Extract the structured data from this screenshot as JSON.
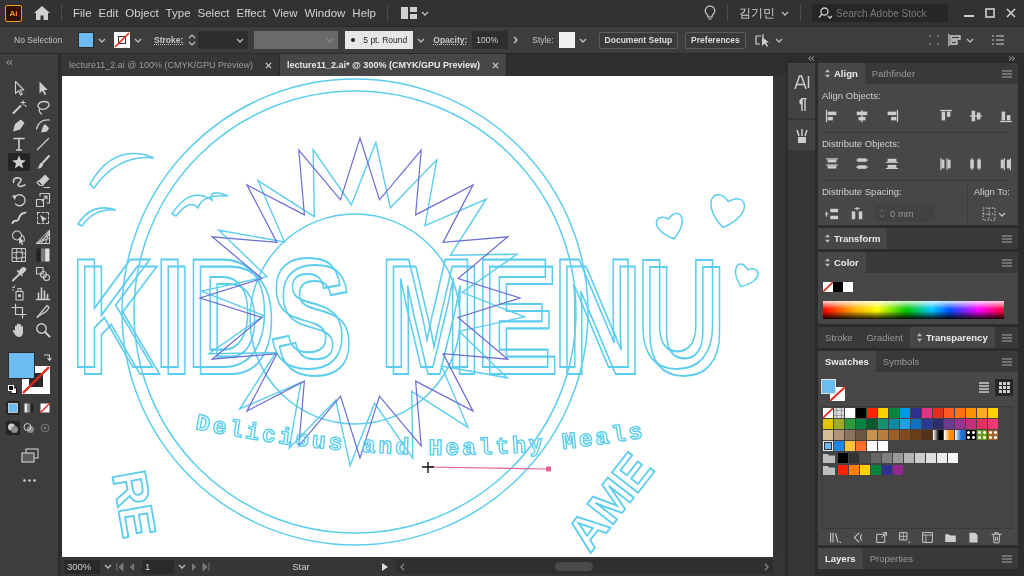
{
  "menu_bar": {
    "logo": "Ai",
    "menus": [
      "File",
      "Edit",
      "Object",
      "Type",
      "Select",
      "Effect",
      "View",
      "Window",
      "Help"
    ],
    "user": "김기민",
    "search": {
      "placeholder": "Search Adobe Stock"
    }
  },
  "control_bar": {
    "selection": "No Selection",
    "stroke_label": "Stroke:",
    "brush": "5 pt. Round",
    "opacity_label": "Opacity:",
    "opacity": "100%",
    "style_label": "Style:",
    "buttons": [
      "Document Setup",
      "Preferences"
    ]
  },
  "document_tabs": [
    {
      "title": "lecture11_2.ai @ 100% (CMYK/GPU Preview)",
      "selected": false
    },
    {
      "title": "lecture11_2.ai* @ 300% (CMYK/GPU Preview)",
      "selected": true
    }
  ],
  "toolbar": {
    "tools": [
      {
        "kind": "selection",
        "selected": false
      },
      {
        "kind": "direct",
        "selected": false
      },
      {
        "kind": "wand",
        "selected": false
      },
      {
        "kind": "lasso",
        "selected": false
      },
      {
        "kind": "pen",
        "selected": false
      },
      {
        "kind": "curvature",
        "selected": false
      },
      {
        "kind": "type",
        "selected": false
      },
      {
        "kind": "line",
        "selected": false
      },
      {
        "kind": "star",
        "selected": true
      },
      {
        "kind": "brush",
        "selected": false
      },
      {
        "kind": "shaper",
        "selected": false
      },
      {
        "kind": "eraser",
        "selected": false
      },
      {
        "kind": "rotate",
        "selected": false
      },
      {
        "kind": "scale",
        "selected": false
      },
      {
        "kind": "warp",
        "selected": false
      },
      {
        "kind": "freetransform",
        "selected": false
      },
      {
        "kind": "shapebuilder",
        "selected": false
      },
      {
        "kind": "perspective",
        "selected": false
      },
      {
        "kind": "mesh",
        "selected": false
      },
      {
        "kind": "gradient",
        "selected": false
      },
      {
        "kind": "eyedropper",
        "selected": false
      },
      {
        "kind": "blend",
        "selected": false
      },
      {
        "kind": "sprayer",
        "selected": false
      },
      {
        "kind": "graph",
        "selected": false
      },
      {
        "kind": "artboard",
        "selected": false
      },
      {
        "kind": "slice",
        "selected": false
      },
      {
        "kind": "hand",
        "selected": false
      },
      {
        "kind": "zoom",
        "selected": false
      }
    ],
    "color_modes": [
      {
        "kind": "color",
        "selected": true
      },
      {
        "kind": "gradient",
        "selected": false
      },
      {
        "kind": "none",
        "selected": false
      }
    ],
    "draw_modes": [
      {
        "kind": "normal",
        "selected": true
      },
      {
        "kind": "behind",
        "selected": false
      },
      {
        "kind": "inside",
        "selected": false
      }
    ]
  },
  "artwork": {
    "title_words": [
      "KIDS",
      "MENU"
    ],
    "tagline": "Delicious and Healthy Meals",
    "arc_texts": [
      "RE",
      "AME"
    ]
  },
  "align_panel": {
    "tabs": [
      {
        "label": "Align",
        "selected": true
      },
      {
        "label": "Pathfinder",
        "selected": false
      }
    ],
    "align_objects_label": "Align Objects:",
    "distribute_objects_label": "Distribute Objects:",
    "distribute_spacing_label": "Distribute Spacing:",
    "spacing": {
      "value": "0 mm",
      "disabled": true
    },
    "align_to_label": "Align To:"
  },
  "transform_panel": {
    "tabs": [
      {
        "label": "Transform",
        "selected": true
      }
    ]
  },
  "color_panel": {
    "tabs": [
      {
        "label": "Color",
        "selected": true
      }
    ]
  },
  "appearance_panel": {
    "tabs": [
      {
        "label": "Stroke",
        "selected": false
      },
      {
        "label": "Gradient",
        "selected": false
      },
      {
        "label": "Transparency",
        "selected": true
      }
    ]
  },
  "swatches_panel": {
    "tabs": [
      {
        "label": "Swatches",
        "selected": true
      },
      {
        "label": "Symbols",
        "selected": false
      }
    ],
    "views": [
      {
        "kind": "list",
        "selected": false
      },
      {
        "kind": "grid",
        "selected": true
      }
    ],
    "swatches": [
      {
        "kind": "none",
        "selected": false
      },
      {
        "kind": "registration",
        "selected": false
      },
      {
        "kind": "color",
        "color": "#ffffff",
        "selected": false
      },
      {
        "kind": "color",
        "color": "#000000",
        "selected": false
      },
      {
        "kind": "color",
        "color": "#ff2400",
        "selected": false
      },
      {
        "kind": "color",
        "color": "#ffd200",
        "selected": false
      },
      {
        "kind": "color",
        "color": "#00853f",
        "selected": false
      },
      {
        "kind": "color",
        "color": "#0096e8",
        "selected": false
      },
      {
        "kind": "color",
        "color": "#2e3192",
        "selected": false
      },
      {
        "kind": "color",
        "color": "#ec2f86",
        "selected": false
      },
      {
        "kind": "color",
        "color": "#e0301e",
        "selected": false
      },
      {
        "kind": "color",
        "color": "#ff5a1f",
        "selected": false
      },
      {
        "kind": "color",
        "color": "#ff7113",
        "selected": false
      },
      {
        "kind": "color",
        "color": "#ff9200",
        "selected": false
      },
      {
        "kind": "color",
        "color": "#ffac1e",
        "selected": false
      },
      {
        "kind": "color",
        "color": "#ffd400",
        "selected": false
      },
      {
        "kind": "color",
        "color": "#e3c600",
        "selected": false
      },
      {
        "kind": "color",
        "color": "#9cad1f",
        "selected": false
      },
      {
        "kind": "color",
        "color": "#2c9b39",
        "selected": false
      },
      {
        "kind": "color",
        "color": "#008340",
        "selected": false
      },
      {
        "kind": "color",
        "color": "#005c2e",
        "selected": false
      },
      {
        "kind": "color",
        "color": "#16916e",
        "selected": false
      },
      {
        "kind": "color",
        "color": "#0a8ba0",
        "selected": false
      },
      {
        "kind": "color",
        "color": "#209fe6",
        "selected": false
      },
      {
        "kind": "color",
        "color": "#1071c4",
        "selected": false
      },
      {
        "kind": "color",
        "color": "#2b3a8f",
        "selected": false
      },
      {
        "kind": "color",
        "color": "#2c2d6c",
        "selected": false
      },
      {
        "kind": "color",
        "color": "#6a3b8f",
        "selected": false
      },
      {
        "kind": "color",
        "color": "#983592",
        "selected": false
      },
      {
        "kind": "color",
        "color": "#c1307b",
        "selected": false
      },
      {
        "kind": "color",
        "color": "#e6305f",
        "selected": false
      },
      {
        "kind": "color",
        "color": "#ee3b73",
        "selected": false
      },
      {
        "kind": "color",
        "color": "#d8be96",
        "selected": false
      },
      {
        "kind": "color",
        "color": "#b39479",
        "selected": false
      },
      {
        "kind": "color",
        "color": "#8b7560",
        "selected": false
      },
      {
        "kind": "color",
        "color": "#6d5641",
        "selected": false
      },
      {
        "kind": "color",
        "color": "#c99451",
        "selected": false
      },
      {
        "kind": "color",
        "color": "#b77e3d",
        "selected": false
      },
      {
        "kind": "color",
        "color": "#9c5f26",
        "selected": false
      },
      {
        "kind": "color",
        "color": "#824a1d",
        "selected": false
      },
      {
        "kind": "color",
        "color": "#6a3d14",
        "selected": false
      },
      {
        "kind": "color",
        "color": "#52331a",
        "selected": false
      },
      {
        "kind": "gradient",
        "color": "#000000",
        "selected": false
      },
      {
        "kind": "gradient",
        "color": "#ff8a00",
        "selected": false
      },
      {
        "kind": "gradient",
        "color": "#1e6fd9",
        "selected": false
      },
      {
        "kind": "pattern",
        "color": "#000000",
        "selected": false
      },
      {
        "kind": "pattern",
        "color": "#6a9a1e",
        "selected": false
      },
      {
        "kind": "pattern",
        "color": "#a0643c",
        "selected": false
      },
      {
        "kind": "color",
        "color": "#6ab8f0",
        "selected": true
      },
      {
        "kind": "color",
        "color": "#1e88e5",
        "selected": false
      },
      {
        "kind": "color",
        "color": "#ffc43a",
        "selected": false
      },
      {
        "kind": "color",
        "color": "#ff6d2e",
        "selected": false
      },
      {
        "kind": "color",
        "color": "#ffffff",
        "selected": false
      },
      {
        "kind": "color",
        "color": "#ffffff",
        "selected": false
      }
    ],
    "groups": [
      {
        "swatches": [
          {
            "kind": "color",
            "color": "#000000",
            "selected": false
          },
          {
            "kind": "color",
            "color": "#333333",
            "selected": false
          },
          {
            "kind": "color",
            "color": "#4d4d4d",
            "selected": false
          },
          {
            "kind": "color",
            "color": "#666666",
            "selected": false
          },
          {
            "kind": "color",
            "color": "#808080",
            "selected": false
          },
          {
            "kind": "color",
            "color": "#999999",
            "selected": false
          },
          {
            "kind": "color",
            "color": "#b3b3b3",
            "selected": false
          },
          {
            "kind": "color",
            "color": "#cccccc",
            "selected": false
          },
          {
            "kind": "color",
            "color": "#e0e0e0",
            "selected": false
          },
          {
            "kind": "color",
            "color": "#ededed",
            "selected": false
          },
          {
            "kind": "color",
            "color": "#f7f7f7",
            "selected": false
          }
        ]
      },
      {
        "swatches": [
          {
            "kind": "color",
            "color": "#ff2400",
            "selected": false
          },
          {
            "kind": "color",
            "color": "#ff7f00",
            "selected": false
          },
          {
            "kind": "color",
            "color": "#ffd200",
            "selected": false
          },
          {
            "kind": "color",
            "color": "#00853f",
            "selected": false
          },
          {
            "kind": "color",
            "color": "#2e3192",
            "selected": false
          },
          {
            "kind": "color",
            "color": "#93278f",
            "selected": false
          }
        ]
      }
    ]
  },
  "layers_panel": {
    "tabs": [
      {
        "label": "Layers",
        "selected": true
      },
      {
        "label": "Properties",
        "selected": false
      }
    ]
  },
  "status_bar": {
    "zoom": "300%",
    "artboard": "1",
    "tool": "Star"
  }
}
